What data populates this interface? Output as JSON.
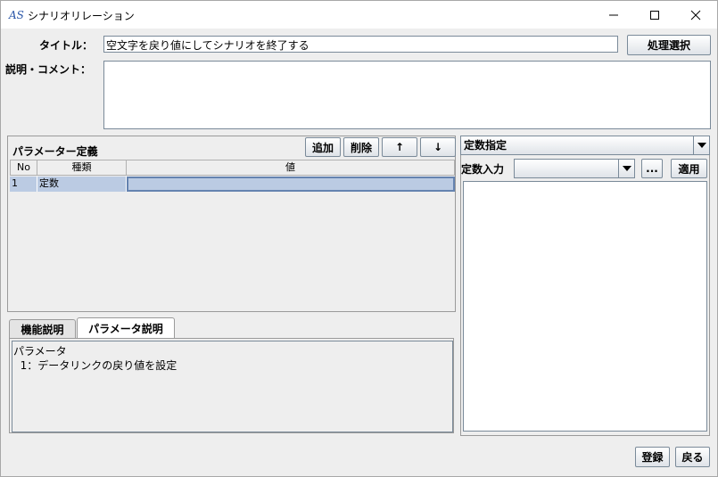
{
  "window": {
    "title": "シナリオリレーション",
    "logo_text": "AS"
  },
  "form": {
    "title_label": "タイトル：",
    "title_value": "空文字を戻り値にしてシナリオを終了する",
    "select_process_button": "処理選択",
    "comment_label": "説明・コメント：",
    "comment_value": ""
  },
  "params": {
    "heading": "パラメーター定義",
    "add_button": "追加",
    "delete_button": "削除",
    "up_button": "↑",
    "down_button": "↓",
    "columns": [
      "No",
      "種類",
      "値"
    ],
    "rows": [
      {
        "no": "1",
        "kind": "定数",
        "value": ""
      }
    ]
  },
  "tabs": {
    "items": [
      "機能説明",
      "パラメータ説明"
    ],
    "active": "パラメータ説明",
    "description": "パラメータ\n  1：データリンクの戻り値を設定"
  },
  "constant": {
    "mode_selected": "定数指定",
    "input_label": "定数入力",
    "input_value": "",
    "ellipsis_button": "...",
    "apply_button": "適用",
    "value_area": ""
  },
  "footer": {
    "register_button": "登録",
    "back_button": "戻る"
  }
}
